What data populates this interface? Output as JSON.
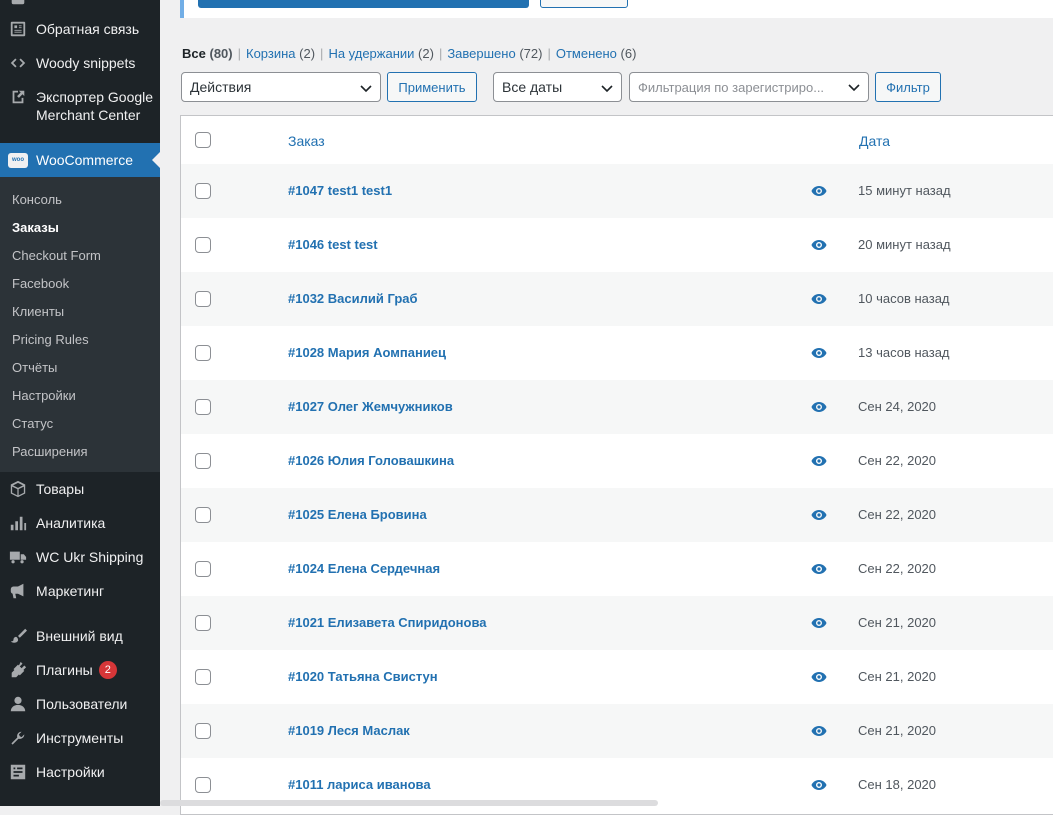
{
  "sidebar": {
    "items_top": [
      {
        "label": "Обратная связь",
        "icon": "feedback-icon"
      },
      {
        "label": "Woody snippets",
        "icon": "snippets-icon"
      },
      {
        "label": "Экспортер Google\nMerchant Center",
        "icon": "export-icon"
      }
    ],
    "woocommerce": {
      "label": "WooCommerce",
      "badge": "woo"
    },
    "submenu": [
      {
        "label": "Консоль"
      },
      {
        "label": "Заказы",
        "current": true
      },
      {
        "label": "Checkout Form"
      },
      {
        "label": "Facebook"
      },
      {
        "label": "Клиенты"
      },
      {
        "label": "Pricing Rules"
      },
      {
        "label": "Отчёты"
      },
      {
        "label": "Настройки"
      },
      {
        "label": "Статус"
      },
      {
        "label": "Расширения"
      }
    ],
    "items_bottom": [
      {
        "label": "Товары",
        "icon": "box-icon"
      },
      {
        "label": "Аналитика",
        "icon": "chart-bar-icon"
      },
      {
        "label": "WC Ukr Shipping",
        "icon": "truck-icon"
      },
      {
        "label": "Маркетинг",
        "icon": "megaphone-icon"
      },
      {
        "label": "Внешний вид",
        "icon": "paintbrush-icon"
      },
      {
        "label": "Плагины",
        "icon": "plugin-icon",
        "count": "2"
      },
      {
        "label": "Пользователи",
        "icon": "user-icon"
      },
      {
        "label": "Инструменты",
        "icon": "wrench-icon"
      },
      {
        "label": "Настройки",
        "icon": "settings-icon"
      }
    ]
  },
  "filters": {
    "all_label": "Все",
    "all_count": "(80)",
    "cart_label": "Корзина",
    "cart_count": "(2)",
    "hold_label": "На удержании",
    "hold_count": "(2)",
    "done_label": "Завершено",
    "done_count": "(72)",
    "cancel_label": "Отменено",
    "cancel_count": "(6)",
    "separator": "|"
  },
  "toolbar": {
    "bulk_actions": "Действия",
    "apply": "Применить",
    "dates": "Все даты",
    "customer_placeholder": "Фильтрация по зарегистриро...",
    "filter": "Фильтр"
  },
  "table": {
    "col_order": "Заказ",
    "col_date": "Дата",
    "rows": [
      {
        "order": "#1047 test1 test1",
        "date": "15 минут назад"
      },
      {
        "order": "#1046 test test",
        "date": "20 минут назад"
      },
      {
        "order": "#1032 Василий Граб",
        "date": "10 часов назад"
      },
      {
        "order": "#1028 Мария Аомпаниец",
        "date": "13 часов назад"
      },
      {
        "order": "#1027 Олег Жемчужников",
        "date": "Сен 24, 2020"
      },
      {
        "order": "#1026 Юлия Головашкина",
        "date": "Сен 22, 2020"
      },
      {
        "order": "#1025 Елена Бровина",
        "date": "Сен 22, 2020"
      },
      {
        "order": "#1024 Елена Сердечная",
        "date": "Сен 22, 2020"
      },
      {
        "order": "#1021 Елизавета Спиридонова",
        "date": "Сен 21, 2020"
      },
      {
        "order": "#1020 Татьяна Свистун",
        "date": "Сен 21, 2020"
      },
      {
        "order": "#1019 Леся Маслак",
        "date": "Сен 21, 2020"
      },
      {
        "order": "#1011 лариса иванова",
        "date": "Сен 18, 2020"
      }
    ]
  },
  "colors": {
    "accent": "#2271b1",
    "sidebar_bg": "#1d2327",
    "submenu_bg": "#2c3338",
    "badge": "#d63638"
  }
}
